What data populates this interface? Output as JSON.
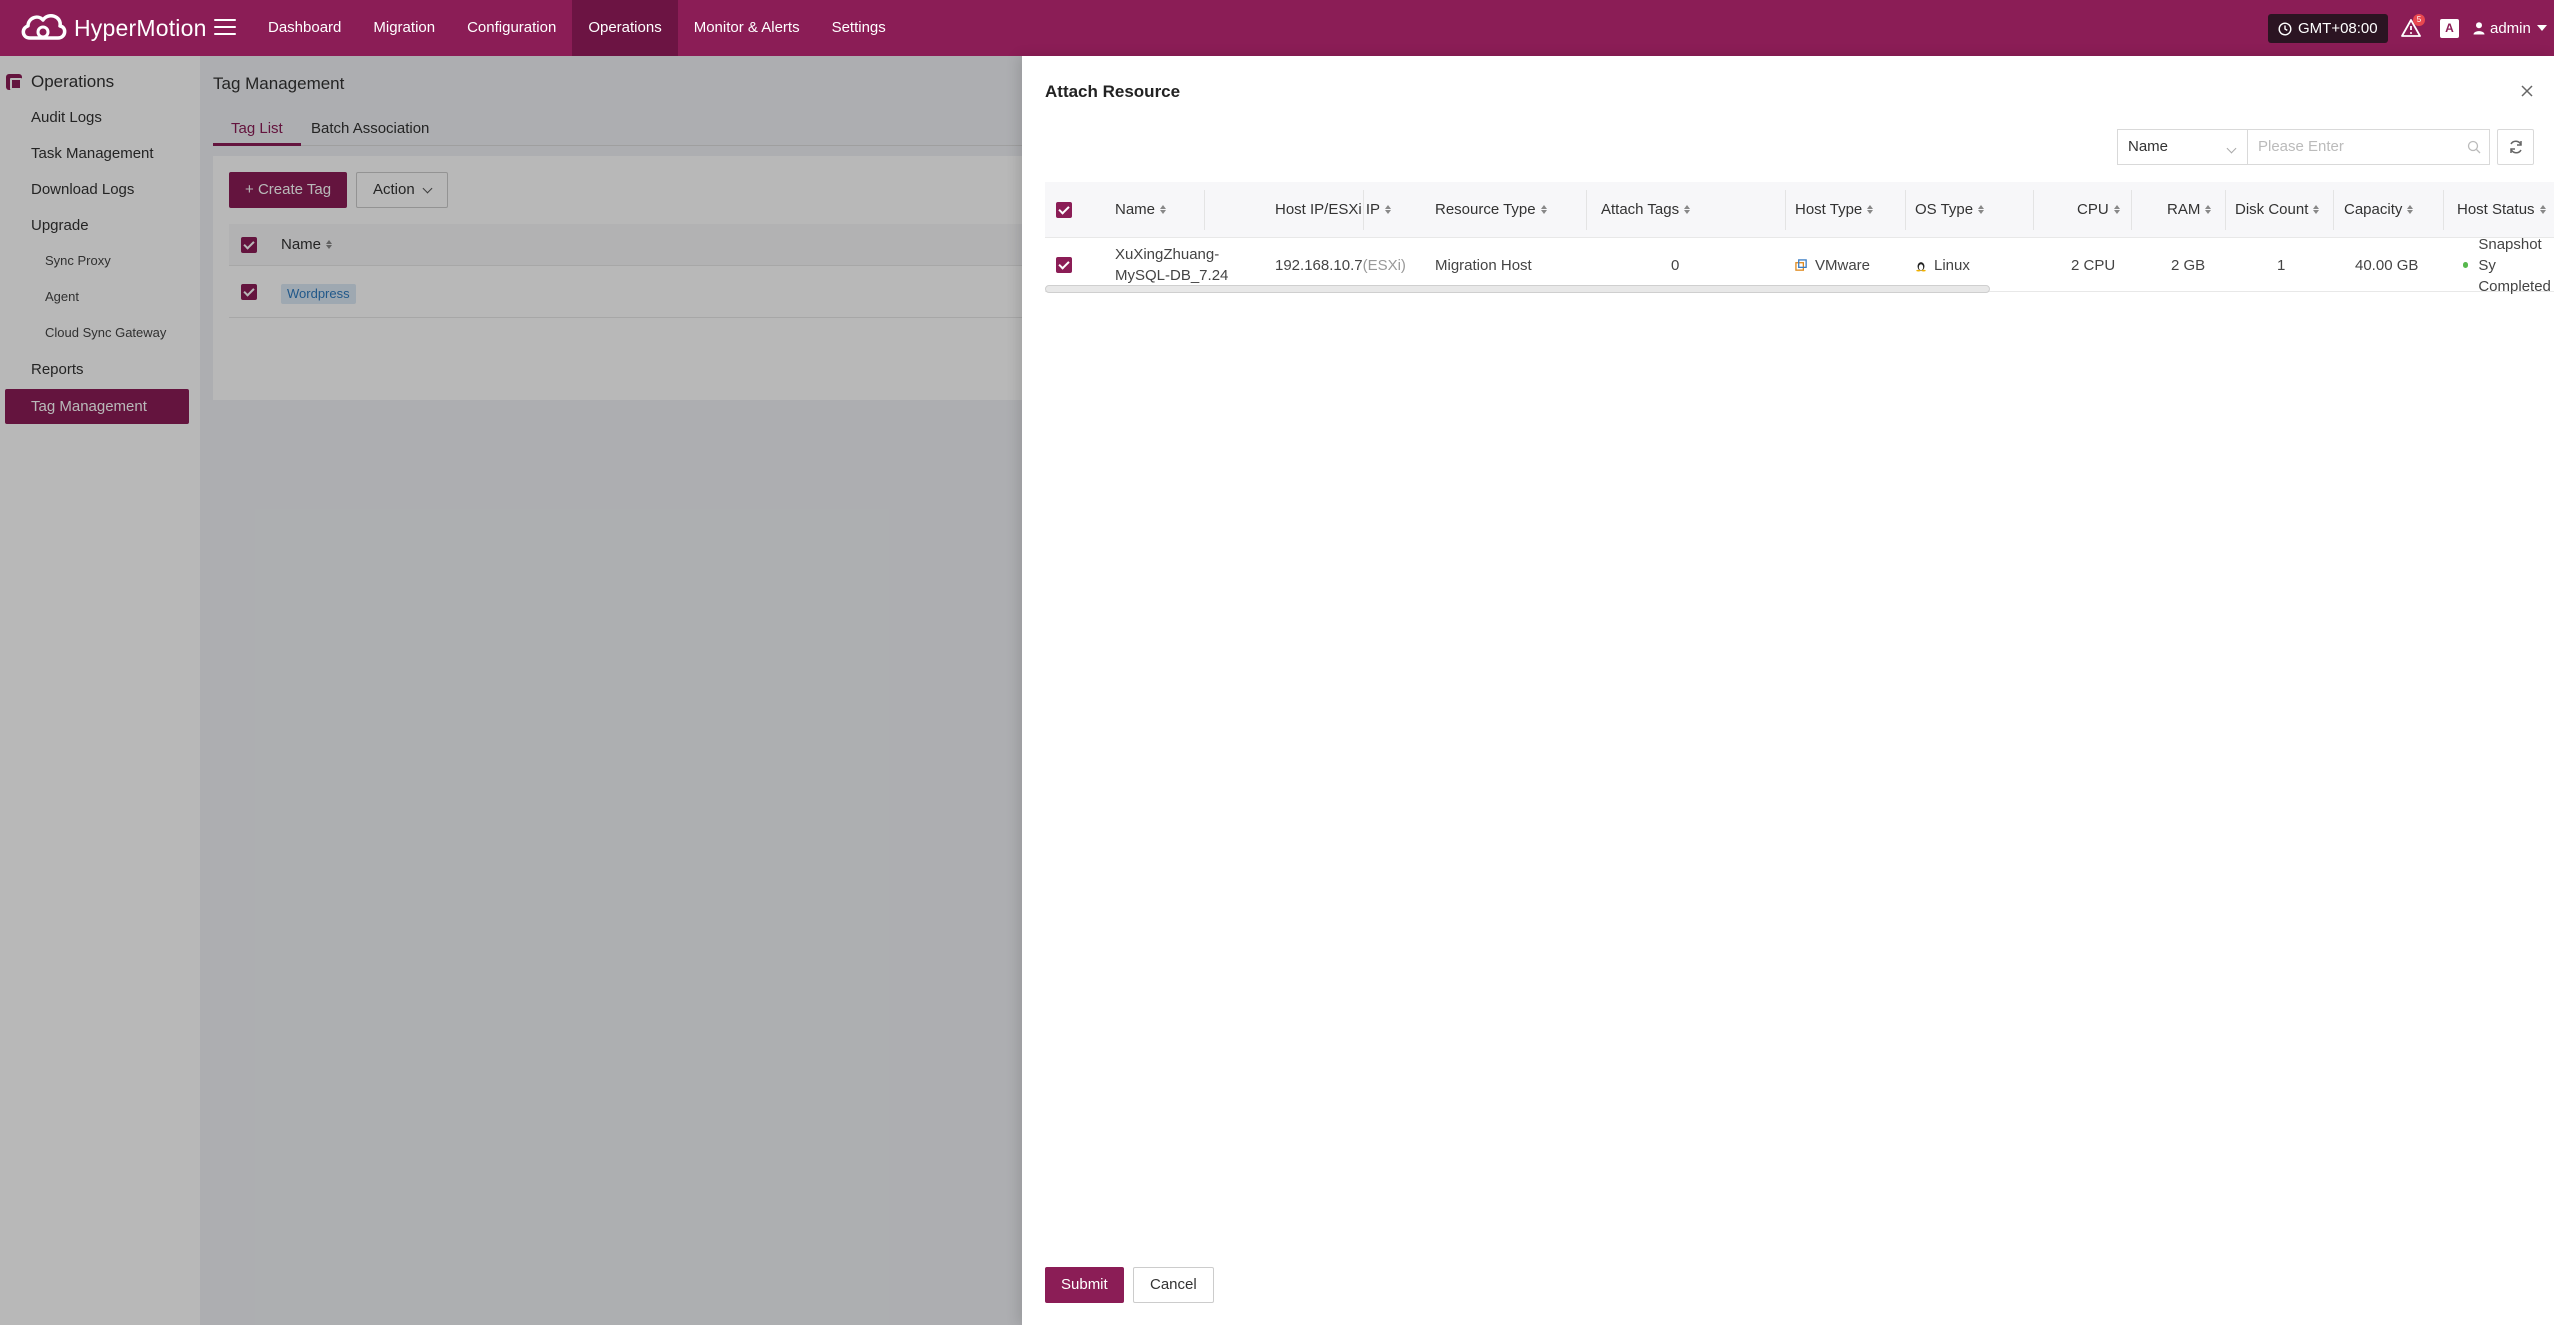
{
  "app": {
    "name": "HyperMotion",
    "brand_color": "#8b1d56"
  },
  "nav": {
    "items": [
      {
        "label": "Dashboard"
      },
      {
        "label": "Migration"
      },
      {
        "label": "Configuration"
      },
      {
        "label": "Operations",
        "active": true
      },
      {
        "label": "Monitor & Alerts"
      },
      {
        "label": "Settings"
      }
    ],
    "timezone": "GMT+08:00",
    "alert_count": "5",
    "lang_icon": "A",
    "user": "admin"
  },
  "sidebar": {
    "section": "Operations",
    "items": [
      {
        "label": "Audit Logs"
      },
      {
        "label": "Task Management"
      },
      {
        "label": "Download Logs"
      },
      {
        "label": "Upgrade"
      },
      {
        "label": "Sync Proxy"
      },
      {
        "label": "Agent"
      },
      {
        "label": "Cloud Sync Gateway"
      },
      {
        "label": "Reports"
      },
      {
        "label": "Tag Management",
        "active": true
      }
    ]
  },
  "page": {
    "title": "Tag Management",
    "tabs": [
      {
        "label": "Tag List",
        "active": true
      },
      {
        "label": "Batch Association"
      }
    ],
    "toolbar": {
      "create_label": "Create Tag",
      "action_label": "Action"
    },
    "list": {
      "header": "Name",
      "rows": [
        {
          "name": "Wordpress",
          "checked": true
        }
      ]
    }
  },
  "drawer": {
    "title": "Attach Resource",
    "filter": {
      "field": "Name",
      "placeholder": "Please Enter"
    },
    "columns": [
      "Name",
      "Host IP/ESXi IP",
      "Resource Type",
      "Attach Tags",
      "Host Type",
      "OS Type",
      "CPU",
      "RAM",
      "Disk Count",
      "Capacity",
      "Host Status"
    ],
    "rows": [
      {
        "name_line1": "XuXingZhuang-",
        "name_line2": "MySQL-DB_7.24",
        "ip": "192.168.10.7",
        "ip_suffix": "(ESXi)",
        "resource_type": "Migration Host",
        "attach_tags": "0",
        "host_type": "VMware",
        "os_type": "Linux",
        "cpu": "2 CPU",
        "ram": "2 GB",
        "disk_count": "1",
        "capacity": "40.00 GB",
        "status_line1": "Snapshot Sy",
        "status_line2": "Completed",
        "checked": true
      }
    ],
    "submit_label": "Submit",
    "cancel_label": "Cancel"
  }
}
